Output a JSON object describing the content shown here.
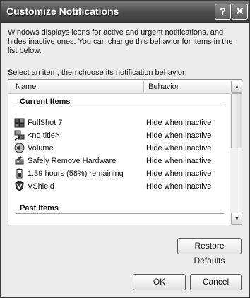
{
  "window": {
    "title": "Customize Notifications",
    "help_glyph": "?",
    "close_glyph": "✕"
  },
  "description": "Windows displays icons for active and urgent notifications, and hides inactive ones. You can change this behavior for items in the list below.",
  "select_label": "Select an item, then choose its notification behavior:",
  "list": {
    "columns": {
      "name": "Name",
      "behavior": "Behavior"
    },
    "current_group": "Current Items",
    "items": [
      {
        "name": "FullShot 7",
        "behavior": "Hide when inactive",
        "icon": "camera-icon"
      },
      {
        "name": "<no title>",
        "behavior": "Hide when inactive",
        "icon": "network-icon"
      },
      {
        "name": "Volume",
        "behavior": "Hide when inactive",
        "icon": "speaker-icon"
      },
      {
        "name": "Safely Remove Hardware",
        "behavior": "Hide when inactive",
        "icon": "hardware-icon"
      },
      {
        "name": "1:39 hours (58%) remaining",
        "behavior": "Hide when inactive",
        "icon": "battery-icon"
      },
      {
        "name": "VShield",
        "behavior": "Hide when inactive",
        "icon": "shield-icon"
      }
    ],
    "past_group": "Past Items"
  },
  "buttons": {
    "restore": "Restore Defaults",
    "ok": "OK",
    "cancel": "Cancel"
  },
  "scrollbar": {
    "up_glyph": "▲",
    "down_glyph": "▼"
  }
}
